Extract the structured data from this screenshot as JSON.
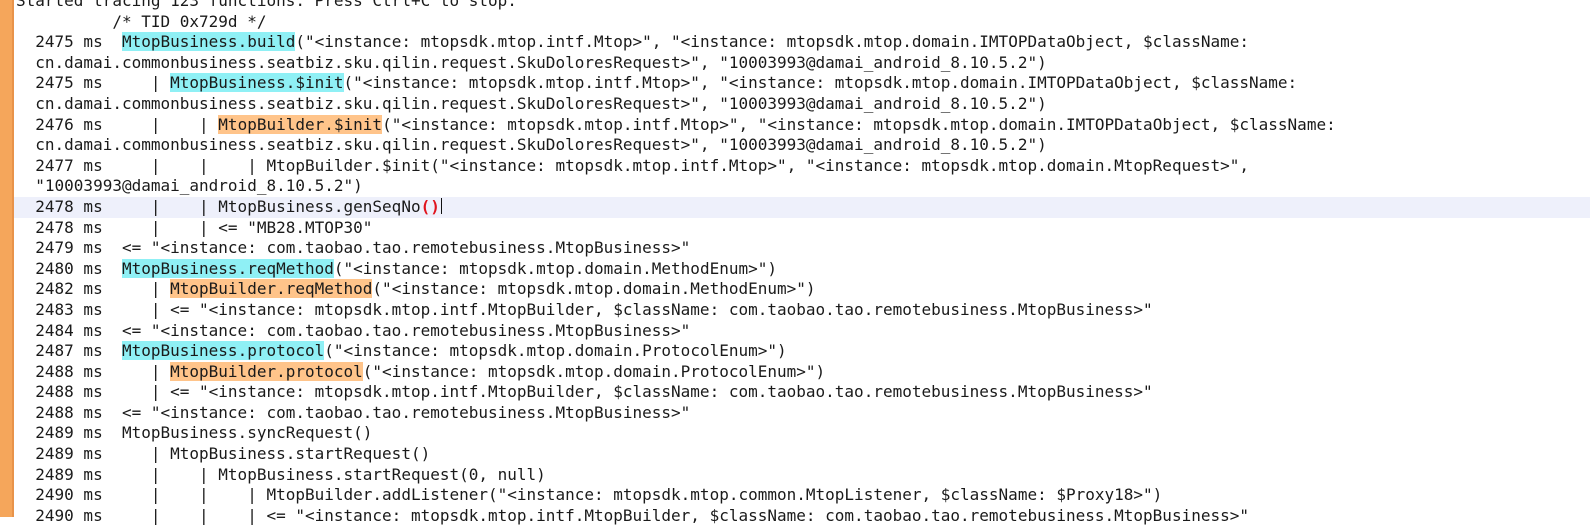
{
  "editor": {
    "accent_color": "#f5a65b",
    "current_line_color": "#eef0fb",
    "highlight_cyan": "#8ff0f5",
    "highlight_orange": "#ffc48a",
    "lines": [
      {
        "a": "Started tracing 123 functions. Press Ctrl+C to stop."
      },
      {
        "a": "          /* TID 0x729d */"
      },
      {
        "a": "  2475 ms  ",
        "h": "MtopBusiness.build",
        "hc": "cyan",
        "b": "(\"<instance: mtopsdk.mtop.intf.Mtop>\", \"<instance: mtopsdk.mtop.domain.IMTOPDataObject, $className:"
      },
      {
        "a": "  cn.damai.commonbusiness.seatbiz.sku.qilin.request.SkuDoloresRequest>\", \"10003993@damai_android_8.10.5.2\")"
      },
      {
        "a": "  2475 ms     | ",
        "h": "MtopBusiness.$init",
        "hc": "cyan",
        "b": "(\"<instance: mtopsdk.mtop.intf.Mtop>\", \"<instance: mtopsdk.mtop.domain.IMTOPDataObject, $className:"
      },
      {
        "a": "  cn.damai.commonbusiness.seatbiz.sku.qilin.request.SkuDoloresRequest>\", \"10003993@damai_android_8.10.5.2\")"
      },
      {
        "a": "  2476 ms     |    | ",
        "h": "MtopBuilder.$init",
        "hc": "orange",
        "b": "(\"<instance: mtopsdk.mtop.intf.Mtop>\", \"<instance: mtopsdk.mtop.domain.IMTOPDataObject, $className:"
      },
      {
        "a": "  cn.damai.commonbusiness.seatbiz.sku.qilin.request.SkuDoloresRequest>\", \"10003993@damai_android_8.10.5.2\")"
      },
      {
        "a": "  2477 ms     |    |    | MtopBuilder.$init(\"<instance: mtopsdk.mtop.intf.Mtop>\", \"<instance: mtopsdk.mtop.domain.MtopRequest>\","
      },
      {
        "a": "  \"10003993@damai_android_8.10.5.2\")"
      },
      {
        "a": "  2478 ms     |    | MtopBusiness.genSeqNo",
        "p": "()",
        "current": true
      },
      {
        "a": "  2478 ms     |    | <= \"MB28.MTOP30\""
      },
      {
        "a": "  2479 ms  <= \"<instance: com.taobao.tao.remotebusiness.MtopBusiness>\""
      },
      {
        "a": "  2480 ms  ",
        "h": "MtopBusiness.reqMethod",
        "hc": "cyan",
        "b": "(\"<instance: mtopsdk.mtop.domain.MethodEnum>\")"
      },
      {
        "a": "  2482 ms     | ",
        "h": "MtopBuilder.reqMethod",
        "hc": "orange",
        "b": "(\"<instance: mtopsdk.mtop.domain.MethodEnum>\")"
      },
      {
        "a": "  2483 ms     | <= \"<instance: mtopsdk.mtop.intf.MtopBuilder, $className: com.taobao.tao.remotebusiness.MtopBusiness>\""
      },
      {
        "a": "  2484 ms  <= \"<instance: com.taobao.tao.remotebusiness.MtopBusiness>\""
      },
      {
        "a": "  2487 ms  ",
        "h": "MtopBusiness.protocol",
        "hc": "cyan",
        "b": "(\"<instance: mtopsdk.mtop.domain.ProtocolEnum>\")"
      },
      {
        "a": "  2488 ms     | ",
        "h": "MtopBuilder.protocol",
        "hc": "orange",
        "b": "(\"<instance: mtopsdk.mtop.domain.ProtocolEnum>\")"
      },
      {
        "a": "  2488 ms     | <= \"<instance: mtopsdk.mtop.intf.MtopBuilder, $className: com.taobao.tao.remotebusiness.MtopBusiness>\""
      },
      {
        "a": "  2488 ms  <= \"<instance: com.taobao.tao.remotebusiness.MtopBusiness>\""
      },
      {
        "a": "  2489 ms  MtopBusiness.syncRequest()"
      },
      {
        "a": "  2489 ms     | MtopBusiness.startRequest()"
      },
      {
        "a": "  2489 ms     |    | MtopBusiness.startRequest(0, null)"
      },
      {
        "a": "  2490 ms     |    |    | MtopBuilder.addListener(\"<instance: mtopsdk.mtop.common.MtopListener, $className: $Proxy18>\")"
      },
      {
        "a": "  2490 ms     |    |    | <= \"<instance: mtopsdk.mtop.intf.MtopBuilder, $className: com.taobao.tao.remotebusiness.MtopBusiness>\""
      }
    ]
  }
}
